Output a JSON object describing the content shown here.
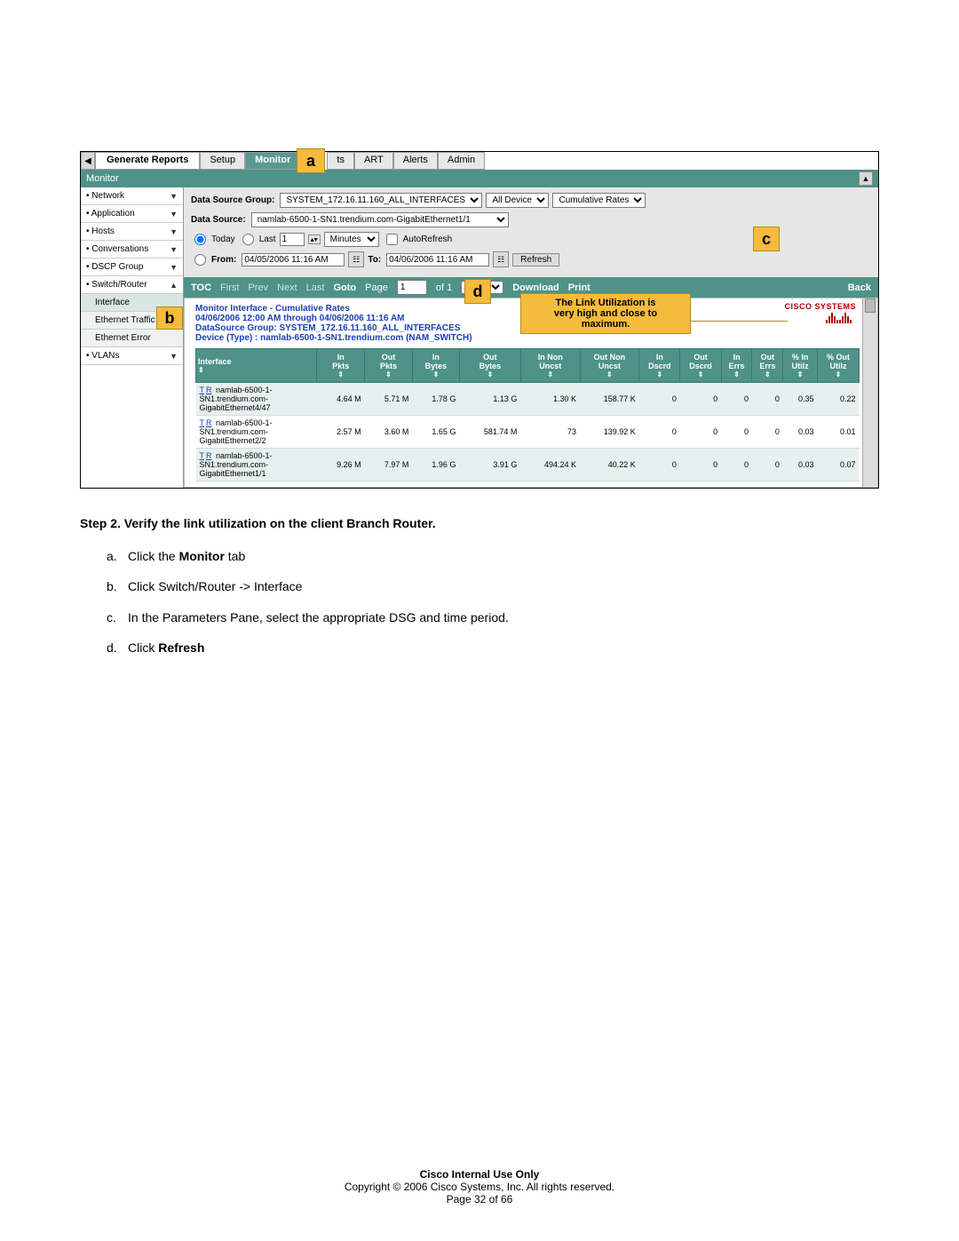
{
  "tabs": {
    "generate": "Generate Reports",
    "setup": "Setup",
    "monitor": "Monitor",
    "t3": "ts",
    "art": "ART",
    "alerts": "Alerts",
    "admin": "Admin"
  },
  "monitorBar": "Monitor",
  "sidebar": {
    "network": "Network",
    "application": "Application",
    "hosts": "Hosts",
    "conversations": "Conversations",
    "dscp": "DSCP Group",
    "switchRouter": "Switch/Router",
    "interface": "Interface",
    "ethTraffic": "Ethernet Traffic",
    "ethError": "Ethernet Error",
    "vlans": "VLANs"
  },
  "filters": {
    "dsgLabel": "Data Source Group:",
    "dsgValue": "SYSTEM_172.16.11.160_ALL_INTERFACES",
    "deviceValue": "All Device",
    "ratesValue": "Cumulative Rates",
    "dsLabel": "Data Source:",
    "dsValue": "namlab-6500-1-SN1.trendium.com-GigabitEthernet1/1",
    "today": "Today",
    "last": "Last",
    "lastVal": "1",
    "minutes": "Minutes",
    "autoRefresh": "AutoRefresh",
    "from": "From:",
    "fromVal": "04/05/2006 11:16 AM",
    "to": "To:",
    "toVal": "04/06/2006 11:16 AM",
    "refresh": "Refresh"
  },
  "markers": {
    "a": "a",
    "b": "b",
    "c": "c",
    "d": "d"
  },
  "navBar": {
    "toc": "TOC",
    "first": "First",
    "prev": "Prev",
    "next": "Next",
    "last": "Last",
    "goto": "Goto",
    "page": "Page",
    "pageVal": "1",
    "of": "of 1",
    "zoom": "100%",
    "download": "Download",
    "print": "Print",
    "back": "Back"
  },
  "callout": {
    "l1": "The Link Utilization is",
    "l2": "very high and close to",
    "l3": "maximum."
  },
  "report": {
    "title": "Monitor Interface - Cumulative Rates",
    "range": "04/06/2006 12:00 AM through 04/06/2006 11:16 AM",
    "dsg": "DataSource Group:   SYSTEM_172.16.11.160_ALL_INTERFACES",
    "device": "Device (Type) :  namlab-6500-1-SN1.trendium.com (NAM_SWITCH)",
    "ciscoLogo": "CISCO SYSTEMS"
  },
  "headers": [
    "Interface",
    "In\nPkts",
    "Out\nPkts",
    "In\nBytes",
    "Out\nBytes",
    "In Non\nUncst",
    "Out Non\nUncst",
    "In\nDscrd",
    "Out\nDscrd",
    "In\nErrs",
    "Out\nErrs",
    "% In\nUtilz",
    "% Out\nUtilz"
  ],
  "rows": [
    {
      "iface": "namlab-6500-1-\nSN1.trendium.com-\nGigabitEthernet4/47",
      "v": [
        "4.64 M",
        "5.71 M",
        "1.78 G",
        "1.13 G",
        "1.30 K",
        "158.77 K",
        "0",
        "0",
        "0",
        "0",
        "0.35",
        "0.22"
      ]
    },
    {
      "iface": "namlab-6500-1-\nSN1.trendium.com-\nGigabitEthernet2/2",
      "v": [
        "2.57 M",
        "3.60 M",
        "1.65 G",
        "581.74 M",
        "73",
        "139.92 K",
        "0",
        "0",
        "0",
        "0",
        "0.03",
        "0.01"
      ]
    },
    {
      "iface": "namlab-6500-1-\nSN1.trendium.com-\nGigabitEthernet1/1",
      "v": [
        "9.26 M",
        "7.97 M",
        "1.96 G",
        "3.91 G",
        "494.24 K",
        "40.22 K",
        "0",
        "0",
        "0",
        "0",
        "0.03",
        "0.07"
      ]
    }
  ],
  "step": {
    "head": "Step 2. Verify the link utilization on the client Branch Router.",
    "a": "Click the ",
    "a2": "Monitor",
    "a3": " tab",
    "b": "Click Switch/Router -> Interface",
    "c": "In the Parameters Pane, select the appropriate DSG and time period.",
    "d": "Click ",
    "d2": "Refresh"
  },
  "footer": {
    "l1": "Cisco Internal Use Only",
    "l2": "Copyright © 2006 Cisco Systems, Inc. All rights reserved.",
    "l3": "Page 32 of 66"
  }
}
